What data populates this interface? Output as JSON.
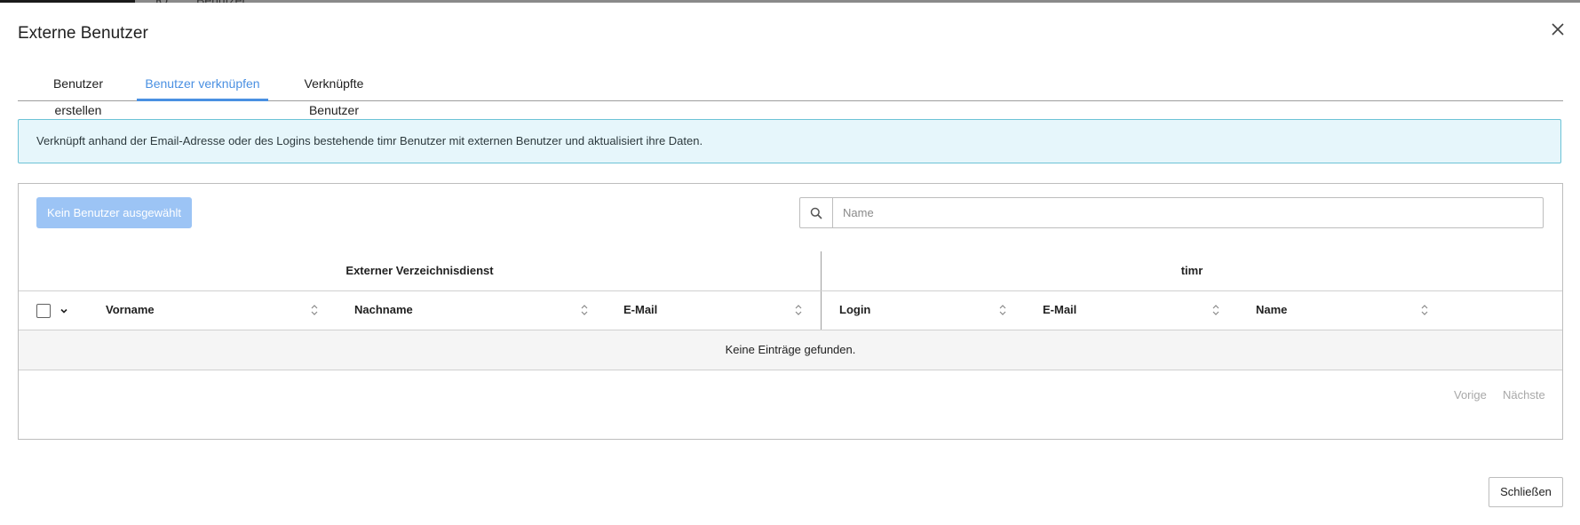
{
  "background": {
    "col_label": "Ю",
    "page_label": "Benutzer"
  },
  "dialog": {
    "title": "Externe Benutzer",
    "close_icon": "close-icon",
    "tabs": [
      {
        "label": "Benutzer erstellen",
        "active": false
      },
      {
        "label": "Benutzer verknüpfen",
        "active": true
      },
      {
        "label": "Verknüpfte Benutzer",
        "active": false
      }
    ],
    "info_text": "Verknüpft anhand der Email-Adresse oder des Logins bestehende timr Benutzer mit externen Benutzer und aktualisiert ihre Daten.",
    "assign_button_label": "Kein Benutzer ausgewählt",
    "search": {
      "placeholder": "Name",
      "value": "",
      "icon": "search-icon"
    },
    "table": {
      "groups": [
        "Externer Verzeichnisdienst",
        "timr"
      ],
      "columns": [
        "Vorname",
        "Nachname",
        "E-Mail",
        "Login",
        "E-Mail",
        "Name"
      ],
      "empty_text": "Keine Einträge gefunden."
    },
    "pager": {
      "prev": "Vorige",
      "next": "Nächste"
    },
    "close_button_label": "Schließen"
  },
  "colors": {
    "accent": "#4a90e2",
    "info_bg": "#e6f6fb",
    "info_border": "#6cc3d6",
    "disabled_button": "#9cc4f5"
  }
}
